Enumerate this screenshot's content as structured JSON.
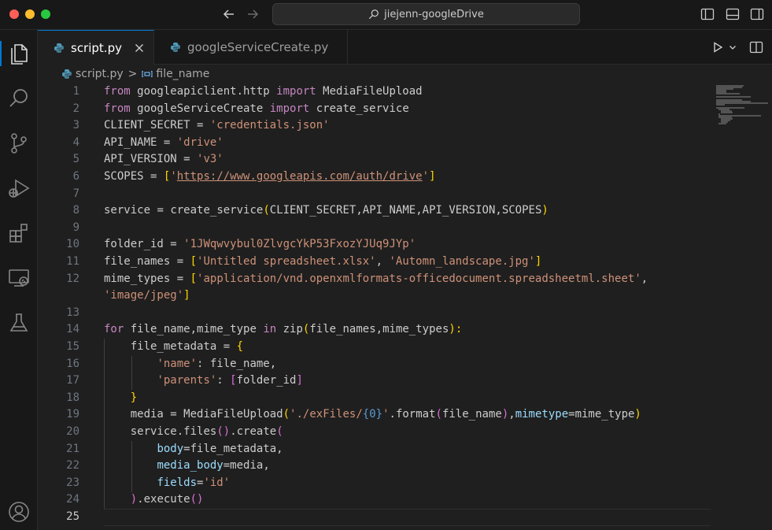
{
  "window": {
    "search_title": "jiejenn-googleDrive"
  },
  "tabs": [
    {
      "label": "script.py",
      "active": true
    },
    {
      "label": "googleServiceCreate.py",
      "active": false
    }
  ],
  "breadcrumb": {
    "file": "script.py",
    "separator": ">",
    "symbol": "file_name"
  },
  "editor": {
    "current_line": 25,
    "lines": [
      {
        "n": 1
      },
      {
        "n": 2
      },
      {
        "n": 3
      },
      {
        "n": 4
      },
      {
        "n": 5
      },
      {
        "n": 6
      },
      {
        "n": 7
      },
      {
        "n": 8
      },
      {
        "n": 9
      },
      {
        "n": 10
      },
      {
        "n": 11
      },
      {
        "n": 12
      },
      {
        "n": 13
      },
      {
        "n": 14
      },
      {
        "n": 15
      },
      {
        "n": 16
      },
      {
        "n": 17
      },
      {
        "n": 18
      },
      {
        "n": 19
      },
      {
        "n": 20
      },
      {
        "n": 21
      },
      {
        "n": 22
      },
      {
        "n": 23
      },
      {
        "n": 24
      },
      {
        "n": 25
      }
    ],
    "code": {
      "l1": [
        "from",
        " googleapiclient.http ",
        "import",
        " MediaFileUpload"
      ],
      "l2": [
        "from",
        " googleServiceCreate ",
        "import",
        " create_service"
      ],
      "l3": [
        "CLIENT_SECRET",
        " = ",
        "'credentials.json'"
      ],
      "l4": [
        "API_NAME",
        " = ",
        "'drive'"
      ],
      "l5": [
        "API_VERSION",
        " = ",
        "'v3'"
      ],
      "l6": [
        "SCOPES",
        " = ",
        "[",
        "'",
        "https://www.googleapis.com/auth/drive",
        "'",
        "]"
      ],
      "l8": [
        "service",
        " = ",
        "create_service",
        "(",
        "CLIENT_SECRET",
        ",",
        "API_NAME",
        ",",
        "API_VERSION",
        ",",
        "SCOPES",
        ")"
      ],
      "l10": [
        "folder_id",
        " = ",
        "'1JWqwvybul0ZlvgcYkP53FxozYJUq9JYp'"
      ],
      "l11": [
        "file_names",
        " = ",
        "[",
        "'Untitled spreadsheet.xlsx'",
        ", ",
        "'Automn_landscape.jpg'",
        "]"
      ],
      "l12": [
        "mime_types",
        " = ",
        "[",
        "'application/vnd.openxmlformats-officedocument.spreadsheetml.sheet'",
        ","
      ],
      "l12b": [
        "'image/jpeg'",
        "]"
      ],
      "l14": [
        "for",
        " ",
        "file_name",
        ",",
        "mime_type",
        " ",
        "in",
        " ",
        "zip",
        "(",
        "file_names",
        ",",
        "mime_types",
        "):"
      ],
      "l15": [
        "file_metadata",
        " = ",
        "{"
      ],
      "l16": [
        "'name'",
        ": ",
        "file_name",
        ","
      ],
      "l17": [
        "'parents'",
        ": ",
        "[",
        "folder_id",
        "]"
      ],
      "l18": [
        "}"
      ],
      "l19": [
        "media",
        " = ",
        "MediaFileUpload",
        "(",
        "'./exFiles/",
        "{0}",
        "'",
        ".",
        "format",
        "(",
        "file_name",
        ")",
        ",",
        "mimetype",
        "=",
        "mime_type",
        ")"
      ],
      "l20": [
        "service",
        ".",
        "files",
        "()",
        ".",
        "create",
        "("
      ],
      "l21": [
        "body",
        "=",
        "file_metadata",
        ","
      ],
      "l22": [
        "media_body",
        "=",
        "media",
        ","
      ],
      "l23": [
        "fields",
        "=",
        "'id'"
      ],
      "l24": [
        ")",
        ".",
        "execute",
        "()"
      ]
    }
  },
  "colors": {
    "accent": "#0078d4",
    "keyword": "#c586c0",
    "string": "#ce9178",
    "function": "#dcdcaa",
    "variable": "#9cdcfe"
  }
}
